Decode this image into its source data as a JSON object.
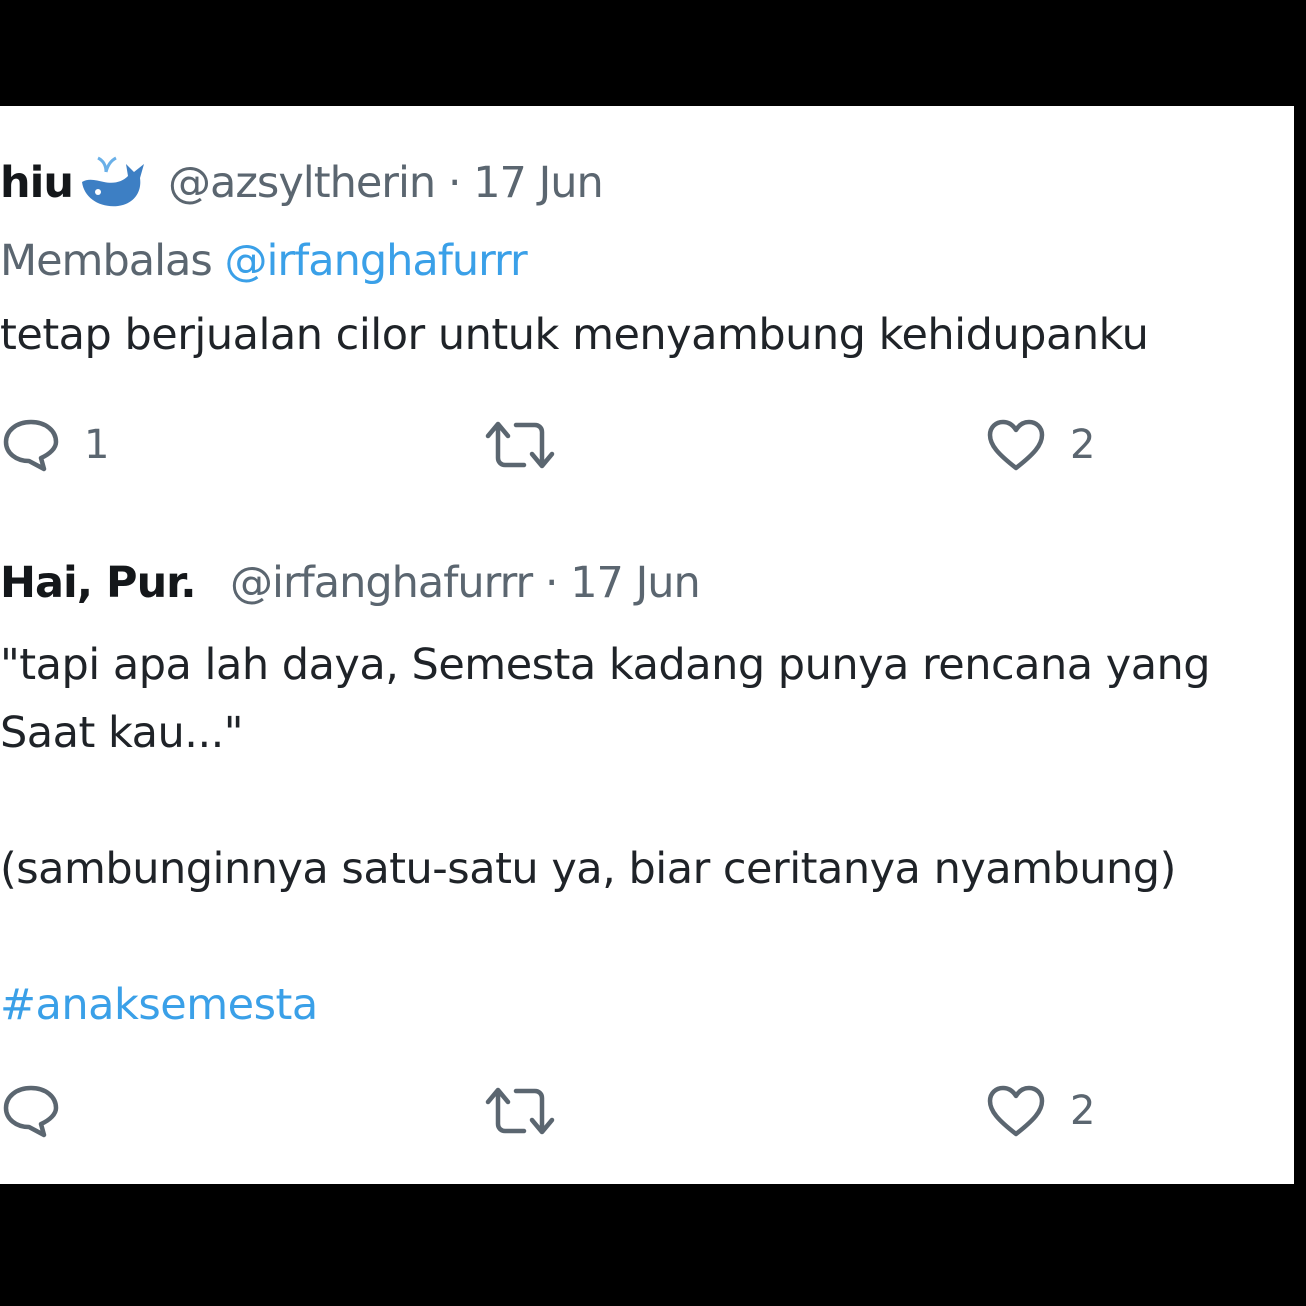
{
  "tweet1": {
    "name": "hiu",
    "emoji_icon": "whale-icon",
    "handle": "@azsyltherin",
    "separator": "·",
    "date": "17 Jun",
    "reply_prefix": "Membalas",
    "reply_to": "@irfanghafurrr",
    "text": "tetap berjualan cilor untuk menyambung kehidupanku",
    "actions": {
      "reply_icon": "speech-bubble-icon",
      "reply_count": "1",
      "retweet_icon": "retweet-icon",
      "like_icon": "heart-icon",
      "like_count": "2"
    }
  },
  "tweet2": {
    "name": "Hai, Pur.",
    "handle": "@irfanghafurrr",
    "separator": "·",
    "date": "17 Jun",
    "line1": "\"tapi apa lah daya, Semesta kadang punya rencana yang",
    "line2": "Saat kau...\"",
    "line3": "(sambunginnya satu-satu ya, biar ceritanya nyambung)",
    "hashtag": "#anaksemesta",
    "actions": {
      "reply_icon": "speech-bubble-icon",
      "retweet_icon": "retweet-icon",
      "like_icon": "heart-icon",
      "like_count": "2"
    }
  },
  "colors": {
    "link": "#3aa0e8",
    "text": "#1f2328",
    "muted": "#5b6670",
    "background": "#ffffff",
    "letterbox": "#000000"
  }
}
